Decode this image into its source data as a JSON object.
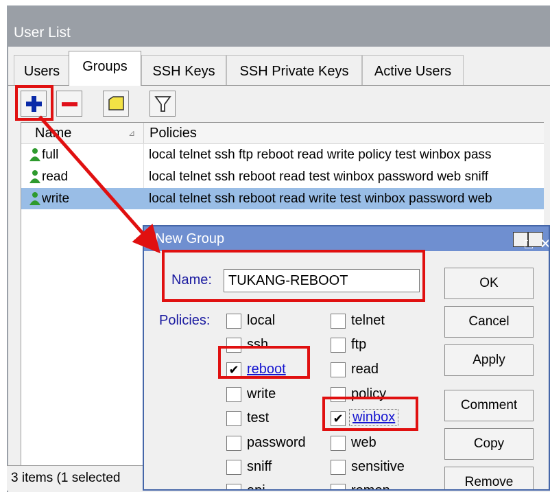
{
  "window": {
    "title": "User List"
  },
  "tabs": [
    {
      "label": "Users"
    },
    {
      "label": "Groups"
    },
    {
      "label": "SSH Keys"
    },
    {
      "label": "SSH Private Keys"
    },
    {
      "label": "Active Users"
    }
  ],
  "toolbar": {
    "add": "add-icon",
    "remove": "remove-icon",
    "comment": "comment-icon",
    "filter": "filter-icon"
  },
  "table": {
    "columns": [
      "Name",
      "Policies"
    ],
    "rows": [
      {
        "name": "full",
        "policies": "local telnet ssh ftp reboot read write policy test winbox pass"
      },
      {
        "name": "read",
        "policies": "local telnet ssh reboot read test winbox password web sniff"
      },
      {
        "name": "write",
        "policies": "local telnet ssh reboot read write test winbox password web"
      }
    ],
    "selected_row": 2
  },
  "status": {
    "text": "3 items (1 selected"
  },
  "dialog": {
    "title": "New Group",
    "name_label": "Name:",
    "name_value": "TUKANG-REBOOT",
    "policies_label": "Policies:",
    "policies_left": [
      {
        "label": "local",
        "checked": false
      },
      {
        "label": "ssh",
        "checked": false
      },
      {
        "label": "reboot",
        "checked": true
      },
      {
        "label": "write",
        "checked": false
      },
      {
        "label": "test",
        "checked": false
      },
      {
        "label": "password",
        "checked": false
      },
      {
        "label": "sniff",
        "checked": false
      },
      {
        "label": "api",
        "checked": false
      }
    ],
    "policies_right": [
      {
        "label": "telnet",
        "checked": false
      },
      {
        "label": "ftp",
        "checked": false
      },
      {
        "label": "read",
        "checked": false
      },
      {
        "label": "policy",
        "checked": false
      },
      {
        "label": "winbox",
        "checked": true
      },
      {
        "label": "web",
        "checked": false
      },
      {
        "label": "sensitive",
        "checked": false
      },
      {
        "label": "romon",
        "checked": false
      }
    ],
    "buttons": {
      "ok": "OK",
      "cancel": "Cancel",
      "apply": "Apply",
      "comment": "Comment",
      "copy": "Copy",
      "remove": "Remove"
    },
    "restore_glyph": "□",
    "close_glyph": "✕"
  },
  "colors": {
    "highlight": "#e01010",
    "selection": "#99bde6",
    "dialog_title": "#6f8fd0"
  }
}
